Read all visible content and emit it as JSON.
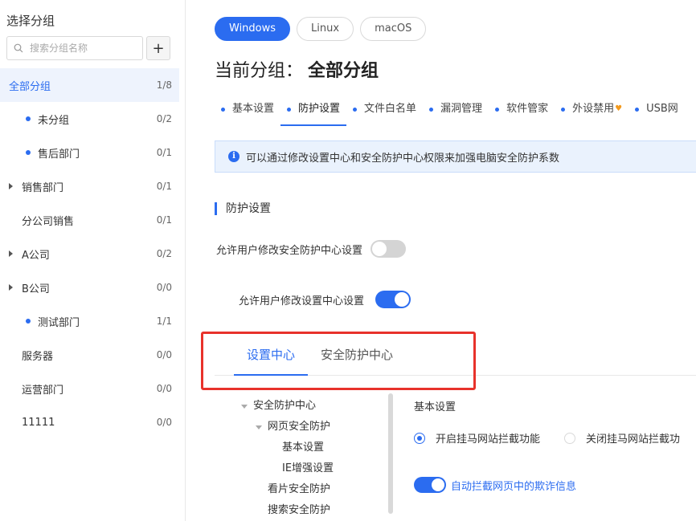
{
  "sidebar": {
    "title": "选择分组",
    "search_placeholder": "搜索分组名称",
    "add_label": "+",
    "items": [
      {
        "label": "全部分组",
        "count": "1/8"
      },
      {
        "label": "未分组",
        "count": "0/2"
      },
      {
        "label": "售后部门",
        "count": "0/1"
      },
      {
        "label": "销售部门",
        "count": "0/1"
      },
      {
        "label": "分公司销售",
        "count": "0/1"
      },
      {
        "label": "A公司",
        "count": "0/2"
      },
      {
        "label": "B公司",
        "count": "0/0"
      },
      {
        "label": "测试部门",
        "count": "1/1"
      },
      {
        "label": "服务器",
        "count": "0/0"
      },
      {
        "label": "运营部门",
        "count": "0/0"
      },
      {
        "label": "11111",
        "count": "0/0"
      }
    ]
  },
  "os_tabs": [
    "Windows",
    "Linux",
    "macOS"
  ],
  "group_header": {
    "label": "当前分组：",
    "value": "全部分组"
  },
  "feature_tabs": [
    "基本设置",
    "防护设置",
    "文件白名单",
    "漏洞管理",
    "软件管家",
    "外设禁用",
    "USB网"
  ],
  "info_text": "可以通过修改设置中心和安全防护中心权限来加强电脑安全防护系数",
  "section_title": "防护设置",
  "settings": {
    "allow_security_center": {
      "label": "允许用户修改安全防护中心设置",
      "enabled": false
    },
    "allow_settings_center": {
      "label": "允许用户修改设置中心设置",
      "enabled": true
    }
  },
  "sub_tabs": [
    "设置中心",
    "安全防护中心"
  ],
  "tree": [
    "安全防护中心",
    "网页安全防护",
    "基本设置",
    "IE增强设置",
    "看片安全防护",
    "搜索安全防护"
  ],
  "basic": {
    "title": "基本设置",
    "radio_on": "开启挂马网站拦截功能",
    "radio_off": "关闭挂马网站拦截功",
    "auto_block": "自动拦截网页中的欺诈信息"
  },
  "colors": {
    "accent": "#2b6cf0",
    "highlight_frame": "#e8322b",
    "warning_icon": "#f39a1e"
  }
}
